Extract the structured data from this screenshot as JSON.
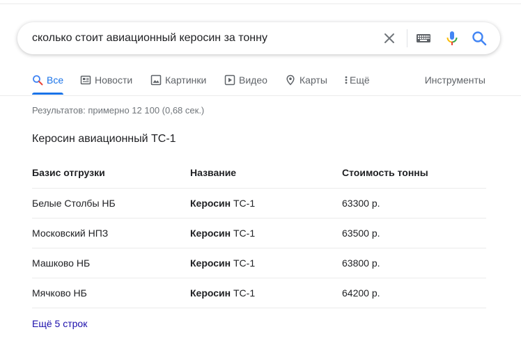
{
  "search": {
    "query": "сколько стоит авиационный керосин за тонну"
  },
  "tabs": [
    {
      "label": "Все",
      "icon": "search-icon",
      "active": true
    },
    {
      "label": "Новости",
      "icon": "news-icon"
    },
    {
      "label": "Картинки",
      "icon": "image-icon"
    },
    {
      "label": "Видео",
      "icon": "video-icon"
    },
    {
      "label": "Карты",
      "icon": "map-pin-icon"
    },
    {
      "label": "Ещё",
      "icon": "more-vert-icon"
    }
  ],
  "tools_label": "Инструменты",
  "stats": "Результатов: примерно 12 100 (0,68 сек.)",
  "featured": {
    "title": "Керосин авиационный ТС-1",
    "headers": [
      "Базис отгрузки",
      "Название",
      "Стоимость тонны"
    ],
    "rows": [
      {
        "basis": "Белые Столбы НБ",
        "name_bold": "Керосин",
        "name_rest": " ТС-1",
        "price": "63300 р."
      },
      {
        "basis": "Московский НПЗ",
        "name_bold": "Керосин",
        "name_rest": " ТС-1",
        "price": "63500 р."
      },
      {
        "basis": "Машково НБ",
        "name_bold": "Керосин",
        "name_rest": " ТС-1",
        "price": "63800 р."
      },
      {
        "basis": "Мячково НБ",
        "name_bold": "Керосин",
        "name_rest": " ТС-1",
        "price": "64200 р."
      }
    ],
    "more_link": "Ещё 5 строк"
  },
  "colors": {
    "accent": "#1a73e8",
    "link": "#1a0dab",
    "mic_blue": "#4285f4",
    "mic_red": "#ea4335",
    "mic_yellow": "#fbbc05",
    "mic_green": "#34a853"
  }
}
